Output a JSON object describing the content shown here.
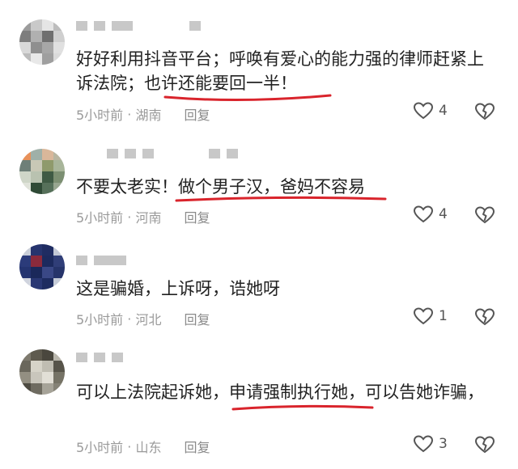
{
  "colors": {
    "accent": "#d9242c",
    "meta": "#9a9a9a",
    "text": "#222222"
  },
  "comments": [
    {
      "text_parts": [
        "好好利用抖音平台；呼唤有爱心的能力强的律师赶紧上诉法院；",
        "也许还能要回一半！"
      ],
      "time": "5小时前",
      "location": "湖南",
      "reply": "回复",
      "likes": "4"
    },
    {
      "text_parts": [
        "不要太老实！",
        "做个男子汉，爸妈不容易"
      ],
      "time": "5小时前",
      "location": "河南",
      "reply": "回复",
      "likes": "4"
    },
    {
      "text_parts": [
        "这是骗婚，上诉呀，诰她呀"
      ],
      "time": "5小时前",
      "location": "河北",
      "reply": "回复",
      "likes": "1"
    },
    {
      "text_parts": [
        "可以上法院起诉她，",
        "申请强制执行她",
        "，可以告她诈骗，"
      ],
      "time": "5小时前",
      "location": "山东",
      "reply": "回复",
      "likes": "3"
    }
  ]
}
